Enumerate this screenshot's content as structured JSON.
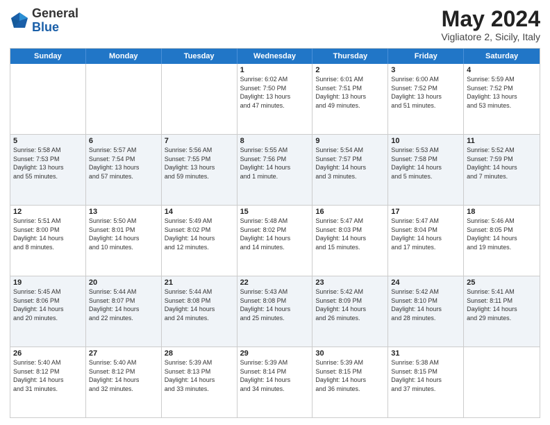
{
  "logo": {
    "general": "General",
    "blue": "Blue"
  },
  "header": {
    "title": "May 2024",
    "subtitle": "Vigliatore 2, Sicily, Italy"
  },
  "weekdays": [
    "Sunday",
    "Monday",
    "Tuesday",
    "Wednesday",
    "Thursday",
    "Friday",
    "Saturday"
  ],
  "rows": [
    [
      {
        "day": "",
        "info": ""
      },
      {
        "day": "",
        "info": ""
      },
      {
        "day": "",
        "info": ""
      },
      {
        "day": "1",
        "info": "Sunrise: 6:02 AM\nSunset: 7:50 PM\nDaylight: 13 hours\nand 47 minutes."
      },
      {
        "day": "2",
        "info": "Sunrise: 6:01 AM\nSunset: 7:51 PM\nDaylight: 13 hours\nand 49 minutes."
      },
      {
        "day": "3",
        "info": "Sunrise: 6:00 AM\nSunset: 7:52 PM\nDaylight: 13 hours\nand 51 minutes."
      },
      {
        "day": "4",
        "info": "Sunrise: 5:59 AM\nSunset: 7:52 PM\nDaylight: 13 hours\nand 53 minutes."
      }
    ],
    [
      {
        "day": "5",
        "info": "Sunrise: 5:58 AM\nSunset: 7:53 PM\nDaylight: 13 hours\nand 55 minutes."
      },
      {
        "day": "6",
        "info": "Sunrise: 5:57 AM\nSunset: 7:54 PM\nDaylight: 13 hours\nand 57 minutes."
      },
      {
        "day": "7",
        "info": "Sunrise: 5:56 AM\nSunset: 7:55 PM\nDaylight: 13 hours\nand 59 minutes."
      },
      {
        "day": "8",
        "info": "Sunrise: 5:55 AM\nSunset: 7:56 PM\nDaylight: 14 hours\nand 1 minute."
      },
      {
        "day": "9",
        "info": "Sunrise: 5:54 AM\nSunset: 7:57 PM\nDaylight: 14 hours\nand 3 minutes."
      },
      {
        "day": "10",
        "info": "Sunrise: 5:53 AM\nSunset: 7:58 PM\nDaylight: 14 hours\nand 5 minutes."
      },
      {
        "day": "11",
        "info": "Sunrise: 5:52 AM\nSunset: 7:59 PM\nDaylight: 14 hours\nand 7 minutes."
      }
    ],
    [
      {
        "day": "12",
        "info": "Sunrise: 5:51 AM\nSunset: 8:00 PM\nDaylight: 14 hours\nand 8 minutes."
      },
      {
        "day": "13",
        "info": "Sunrise: 5:50 AM\nSunset: 8:01 PM\nDaylight: 14 hours\nand 10 minutes."
      },
      {
        "day": "14",
        "info": "Sunrise: 5:49 AM\nSunset: 8:02 PM\nDaylight: 14 hours\nand 12 minutes."
      },
      {
        "day": "15",
        "info": "Sunrise: 5:48 AM\nSunset: 8:02 PM\nDaylight: 14 hours\nand 14 minutes."
      },
      {
        "day": "16",
        "info": "Sunrise: 5:47 AM\nSunset: 8:03 PM\nDaylight: 14 hours\nand 15 minutes."
      },
      {
        "day": "17",
        "info": "Sunrise: 5:47 AM\nSunset: 8:04 PM\nDaylight: 14 hours\nand 17 minutes."
      },
      {
        "day": "18",
        "info": "Sunrise: 5:46 AM\nSunset: 8:05 PM\nDaylight: 14 hours\nand 19 minutes."
      }
    ],
    [
      {
        "day": "19",
        "info": "Sunrise: 5:45 AM\nSunset: 8:06 PM\nDaylight: 14 hours\nand 20 minutes."
      },
      {
        "day": "20",
        "info": "Sunrise: 5:44 AM\nSunset: 8:07 PM\nDaylight: 14 hours\nand 22 minutes."
      },
      {
        "day": "21",
        "info": "Sunrise: 5:44 AM\nSunset: 8:08 PM\nDaylight: 14 hours\nand 24 minutes."
      },
      {
        "day": "22",
        "info": "Sunrise: 5:43 AM\nSunset: 8:08 PM\nDaylight: 14 hours\nand 25 minutes."
      },
      {
        "day": "23",
        "info": "Sunrise: 5:42 AM\nSunset: 8:09 PM\nDaylight: 14 hours\nand 26 minutes."
      },
      {
        "day": "24",
        "info": "Sunrise: 5:42 AM\nSunset: 8:10 PM\nDaylight: 14 hours\nand 28 minutes."
      },
      {
        "day": "25",
        "info": "Sunrise: 5:41 AM\nSunset: 8:11 PM\nDaylight: 14 hours\nand 29 minutes."
      }
    ],
    [
      {
        "day": "26",
        "info": "Sunrise: 5:40 AM\nSunset: 8:12 PM\nDaylight: 14 hours\nand 31 minutes."
      },
      {
        "day": "27",
        "info": "Sunrise: 5:40 AM\nSunset: 8:12 PM\nDaylight: 14 hours\nand 32 minutes."
      },
      {
        "day": "28",
        "info": "Sunrise: 5:39 AM\nSunset: 8:13 PM\nDaylight: 14 hours\nand 33 minutes."
      },
      {
        "day": "29",
        "info": "Sunrise: 5:39 AM\nSunset: 8:14 PM\nDaylight: 14 hours\nand 34 minutes."
      },
      {
        "day": "30",
        "info": "Sunrise: 5:39 AM\nSunset: 8:15 PM\nDaylight: 14 hours\nand 36 minutes."
      },
      {
        "day": "31",
        "info": "Sunrise: 5:38 AM\nSunset: 8:15 PM\nDaylight: 14 hours\nand 37 minutes."
      },
      {
        "day": "",
        "info": ""
      }
    ]
  ]
}
